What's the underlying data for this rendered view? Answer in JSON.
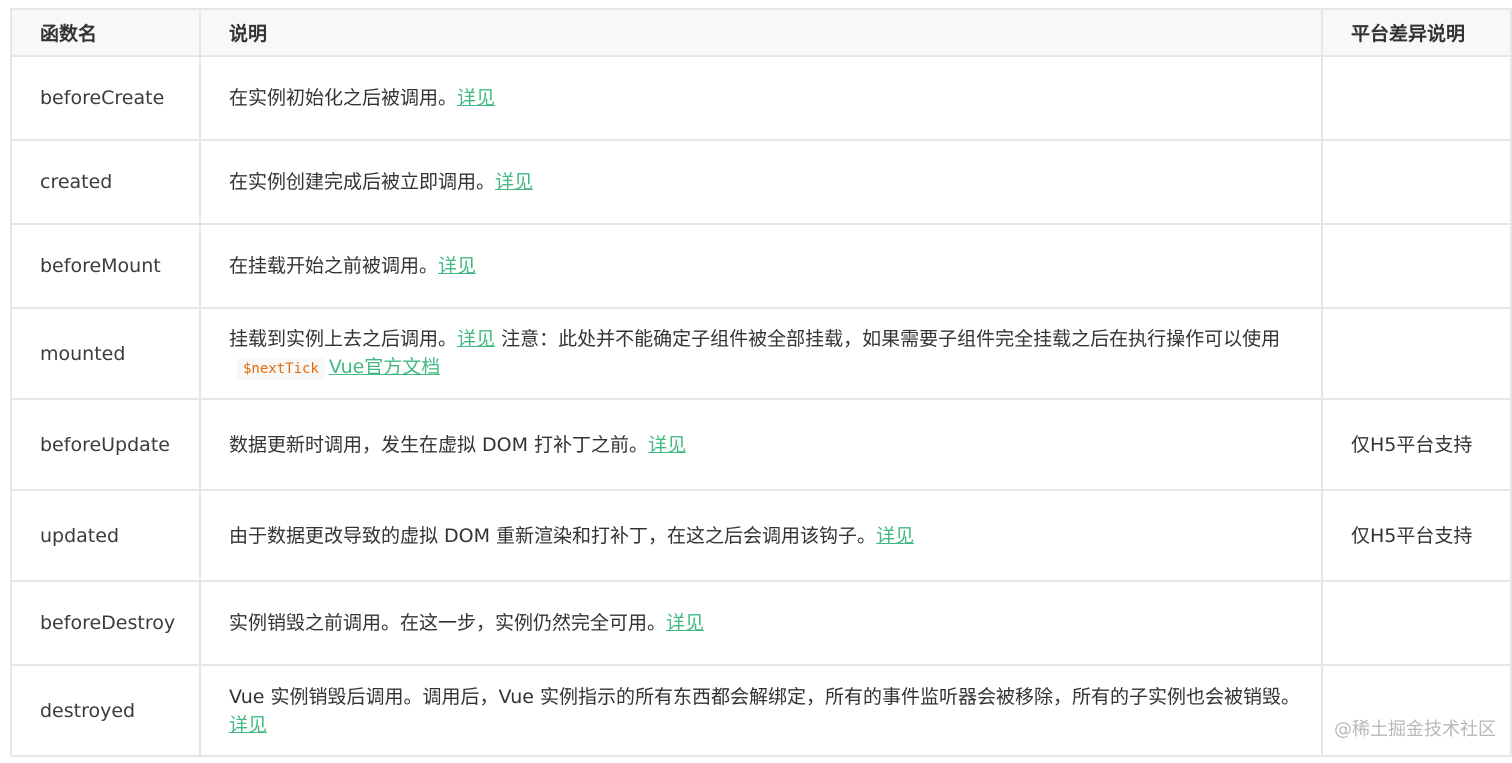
{
  "headers": {
    "name": "函数名",
    "desc": "说明",
    "diff": "平台差异说明"
  },
  "rows": [
    {
      "name": "beforeCreate",
      "desc": "在实例初始化之后被调用。",
      "link": "详见",
      "diff": ""
    },
    {
      "name": "created",
      "desc": "在实例创建完成后被立即调用。",
      "link": "详见",
      "diff": ""
    },
    {
      "name": "beforeMount",
      "desc": "在挂载开始之前被调用。",
      "link": "详见",
      "diff": ""
    },
    {
      "name": "mounted",
      "desc": "挂载到实例上去之后调用。",
      "link": "详见",
      "note": " 注意：此处并不能确定子组件被全部挂载，如果需要子组件完全挂载之后在执行操作可以使用",
      "code": "$nextTick",
      "link2": "Vue官方文档",
      "diff": ""
    },
    {
      "name": "beforeUpdate",
      "desc": "数据更新时调用，发生在虚拟 DOM 打补丁之前。",
      "link": "详见",
      "diff": "仅H5平台支持"
    },
    {
      "name": "updated",
      "desc": "由于数据更改导致的虚拟 DOM 重新渲染和打补丁，在这之后会调用该钩子。",
      "link": "详见",
      "diff": "仅H5平台支持"
    },
    {
      "name": "beforeDestroy",
      "desc": "实例销毁之前调用。在这一步，实例仍然完全可用。",
      "link": "详见",
      "diff": ""
    },
    {
      "name": "destroyed",
      "desc": "Vue 实例销毁后调用。调用后，Vue 实例指示的所有东西都会解绑定，所有的事件监听器会被移除，所有的子实例也会被销毁。",
      "link": "详见",
      "diff": ""
    }
  ],
  "watermark": "@稀土掘金技术社区",
  "colors": {
    "link": "#42b983",
    "code": "#e96900",
    "header_bg": "#f6f8fa",
    "border": "#e6e6e6"
  }
}
